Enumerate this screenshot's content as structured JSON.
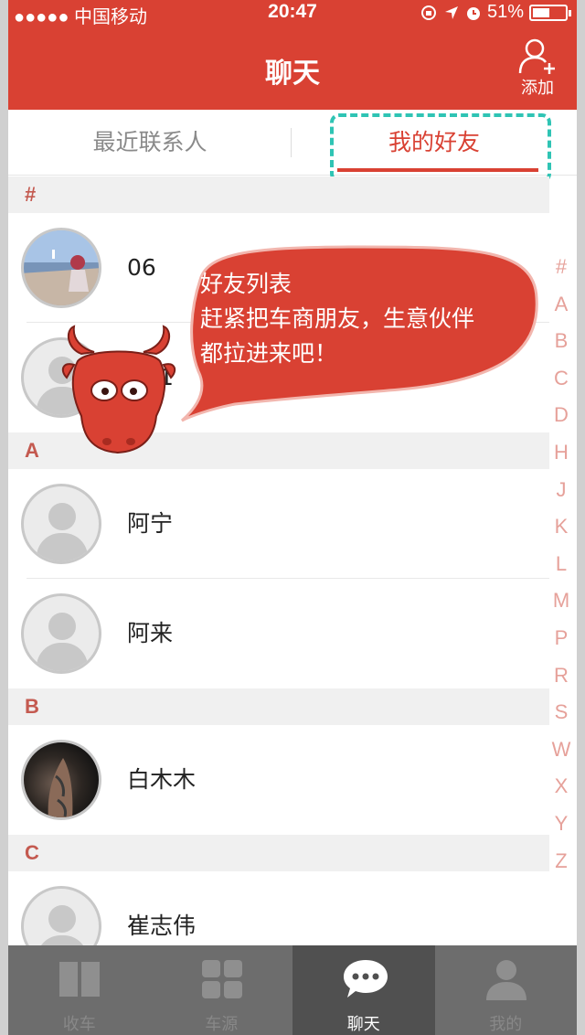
{
  "status_bar": {
    "carrier": "●●●●● 中国移动",
    "time": "20:47",
    "battery": "51%",
    "battery_level": 0.51
  },
  "header": {
    "title": "聊天",
    "add_label": "添加"
  },
  "tabs": [
    {
      "label": "最近联系人",
      "active": false
    },
    {
      "label": "我的好友",
      "active": true
    }
  ],
  "sections": [
    {
      "letter": "#",
      "contacts": [
        {
          "name": "06"
        },
        {
          "name": "1"
        }
      ]
    },
    {
      "letter": "A",
      "contacts": [
        {
          "name": "阿宁"
        },
        {
          "name": "阿来"
        }
      ]
    },
    {
      "letter": "B",
      "contacts": [
        {
          "name": "白木木"
        }
      ]
    },
    {
      "letter": "C",
      "contacts": [
        {
          "name": "崔志伟"
        }
      ]
    }
  ],
  "index_letters": [
    "#",
    "A",
    "B",
    "C",
    "D",
    "H",
    "J",
    "K",
    "L",
    "M",
    "P",
    "R",
    "S",
    "W",
    "X",
    "Y",
    "Z"
  ],
  "tooltip": {
    "line1": "好友列表",
    "line2": "赶紧把车商朋友，生意伙伴",
    "line3": "都拉进来吧！"
  },
  "tabbar": [
    {
      "label": "收车",
      "icon": "book-icon",
      "active": false
    },
    {
      "label": "车源",
      "icon": "grid-icon",
      "active": false
    },
    {
      "label": "聊天",
      "icon": "chat-bubble-icon",
      "active": true
    },
    {
      "label": "我的",
      "icon": "person-icon",
      "active": false
    }
  ],
  "colors": {
    "brand": "#d94133",
    "highlight": "#2fc4b4",
    "index": "#e6a19a"
  }
}
